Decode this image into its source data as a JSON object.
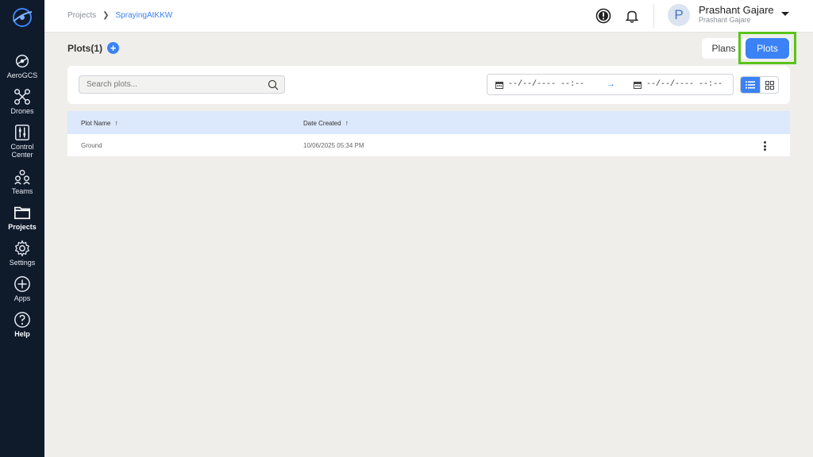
{
  "sidebar": {
    "items": [
      {
        "label": "AeroGCS",
        "icon": "aerogcs-icon"
      },
      {
        "label": "Drones",
        "icon": "drone-icon"
      },
      {
        "label": "Control\nCenter",
        "icon": "control-center-icon"
      },
      {
        "label": "Teams",
        "icon": "teams-icon"
      },
      {
        "label": "Projects",
        "icon": "folder-icon",
        "active": true
      },
      {
        "label": "Settings",
        "icon": "gear-icon"
      },
      {
        "label": "Apps",
        "icon": "plus-circle-icon"
      },
      {
        "label": "Help",
        "icon": "help-icon"
      }
    ]
  },
  "header": {
    "breadcrumb": {
      "root": "Projects",
      "current": "SprayingAtKKW"
    },
    "user": {
      "initial": "P",
      "name": "Prashant Gajare",
      "subtitle": "Prashant Gajare"
    }
  },
  "main": {
    "title": "Plots(1)",
    "add_label": "+",
    "toggle": {
      "plans_label": "Plans",
      "plots_label": "Plots",
      "selected": "Plots"
    },
    "search": {
      "placeholder": "Search plots...",
      "value": ""
    },
    "date_range": {
      "start": "--/--/---- --:--",
      "end": "--/--/---- --:--",
      "arrow": "→"
    },
    "table": {
      "columns": [
        {
          "label": "Plot Name",
          "sort": "↑"
        },
        {
          "label": "Date Created",
          "sort": "↑"
        }
      ],
      "rows": [
        {
          "name": "Ground",
          "date": "10/06/2025 05:34 PM"
        }
      ]
    }
  },
  "colors": {
    "accent": "#3b82f6",
    "sidebar_bg": "#0f1a2b",
    "highlight": "#5ac41a"
  }
}
